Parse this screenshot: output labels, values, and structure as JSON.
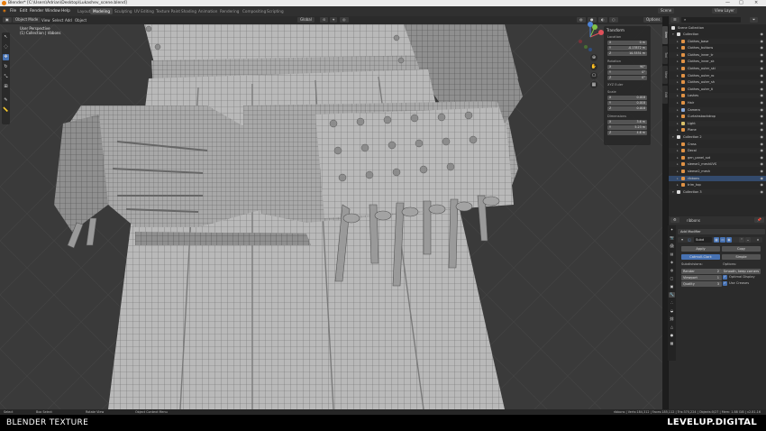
{
  "window": {
    "title": "Blender* [C:\\Users\\Adrian\\Desktop\\Lukashev_scene.blend]",
    "controls": [
      "—",
      "□",
      "×"
    ]
  },
  "menu": {
    "items": [
      "File",
      "Edit",
      "Render",
      "Window",
      "Help"
    ]
  },
  "workspaces": {
    "tabs": [
      "Layout",
      "Modeling",
      "Sculpting",
      "UV Editing",
      "Texture Paint",
      "Shading",
      "Animation",
      "Rendering",
      "Compositing",
      "Scripting"
    ],
    "active": "Modeling"
  },
  "topbar_right": {
    "scene": "Scene",
    "view_layer": "View Layer"
  },
  "header": {
    "mode": "Object Mode",
    "menus": [
      "View",
      "Select",
      "Add",
      "Object"
    ],
    "orientation": "Orientation",
    "transform_space": "Global",
    "pivot": "Global",
    "options": "Options"
  },
  "viewport": {
    "view_name": "User Perspective",
    "collection_info": "(1) Collection | ribbons"
  },
  "tools": [
    "cursor-arrow",
    "select-circle",
    "move",
    "rotate",
    "scale",
    "transform",
    "annotate",
    "measure"
  ],
  "gizmo": {
    "axes": [
      "X",
      "Y",
      "Z"
    ]
  },
  "sidebar_tabs": [
    "Item",
    "Tool",
    "View",
    "Edit"
  ],
  "transform_panel": {
    "title": "Transform",
    "location_label": "Location",
    "location": [
      {
        "axis": "X",
        "value": "0 m"
      },
      {
        "axis": "Y",
        "value": "-0.17872 m"
      },
      {
        "axis": "Z",
        "value": "10.3331 m"
      }
    ],
    "rotation_label": "Rotation",
    "rotation": [
      {
        "axis": "X",
        "value": "90°"
      },
      {
        "axis": "Y",
        "value": "0°"
      },
      {
        "axis": "Z",
        "value": "0°"
      }
    ],
    "mode_label": "XYZ Euler",
    "scale_label": "Scale",
    "scale": [
      {
        "axis": "X",
        "value": "0.018"
      },
      {
        "axis": "Y",
        "value": "0.018"
      },
      {
        "axis": "Z",
        "value": "0.018"
      }
    ],
    "dimensions_label": "Dimensions",
    "dimensions": [
      {
        "axis": "X",
        "value": "3.6 m"
      },
      {
        "axis": "Y",
        "value": "5.23 m"
      },
      {
        "axis": "Z",
        "value": "4.6 m"
      }
    ]
  },
  "outliner": {
    "title": "Scene Collection",
    "rows": [
      {
        "name": "Collection",
        "indent": 1,
        "color": "#ddd",
        "kind": "collection"
      },
      {
        "name": "Clothes_base",
        "indent": 2,
        "color": "#e09245",
        "kind": "mesh"
      },
      {
        "name": "Clothes_buttons",
        "indent": 2,
        "color": "#e09245",
        "kind": "mesh"
      },
      {
        "name": "Clothes_inner_tr",
        "indent": 2,
        "color": "#e09245",
        "kind": "mesh"
      },
      {
        "name": "Clothes_inner_sk",
        "indent": 2,
        "color": "#e09245",
        "kind": "mesh"
      },
      {
        "name": "Clothes_outer_ski",
        "indent": 2,
        "color": "#e09245",
        "kind": "mesh"
      },
      {
        "name": "Clothes_outer_ro",
        "indent": 2,
        "color": "#e09245",
        "kind": "mesh"
      },
      {
        "name": "Clothes_outer_sh",
        "indent": 2,
        "color": "#e09245",
        "kind": "mesh"
      },
      {
        "name": "Clothes_outer_ti",
        "indent": 2,
        "color": "#e09245",
        "kind": "mesh"
      },
      {
        "name": "Lashes",
        "indent": 2,
        "color": "#e09245",
        "kind": "mesh"
      },
      {
        "name": "Hair",
        "indent": 2,
        "color": "#e09245",
        "kind": "mesh"
      },
      {
        "name": "Camera",
        "indent": 2,
        "color": "#8aa8d8",
        "kind": "camera"
      },
      {
        "name": "Curtainsbackdrop",
        "indent": 2,
        "color": "#e09245",
        "kind": "mesh"
      },
      {
        "name": "Light",
        "indent": 2,
        "color": "#d8c06a",
        "kind": "light"
      },
      {
        "name": "Plane",
        "indent": 2,
        "color": "#e09245",
        "kind": "mesh"
      },
      {
        "name": "Collection 2",
        "indent": 1,
        "color": "#ddd",
        "kind": "collection"
      },
      {
        "name": "Cross",
        "indent": 2,
        "color": "#e09245",
        "kind": "mesh"
      },
      {
        "name": "Decal",
        "indent": 2,
        "color": "#e09245",
        "kind": "mesh"
      },
      {
        "name": "gen_panel_sot",
        "indent": 2,
        "color": "#e09245",
        "kind": "mesh"
      },
      {
        "name": "sleeve1_meshUVS",
        "indent": 2,
        "color": "#e09245",
        "kind": "mesh"
      },
      {
        "name": "sleeve2_mesh",
        "indent": 2,
        "color": "#e09245",
        "kind": "mesh"
      },
      {
        "name": "ribbons",
        "indent": 2,
        "color": "#e09245",
        "kind": "mesh",
        "selected": true
      },
      {
        "name": "trim_top",
        "indent": 2,
        "color": "#e09245",
        "kind": "mesh"
      },
      {
        "name": "Collection 3",
        "indent": 1,
        "color": "#ddd",
        "kind": "collection"
      }
    ]
  },
  "properties": {
    "object_label": "ribbons",
    "add_modifier": "Add Modifier",
    "modifier_name": "Subd",
    "apply": "Apply",
    "copy": "Copy",
    "catmull_clark": "Catmull-Clark",
    "simple": "Simple",
    "subdivisions_label": "Subdivisions:",
    "render_label": "Render",
    "render_value": "2",
    "viewport_label": "Viewport",
    "viewport_value": "1",
    "quality_label": "Quality",
    "quality_value": "3",
    "options_label": "Options:",
    "uv_smooth": "Smooth, keep corners",
    "optimal_display": "Optimal Display",
    "use_creases": "Use Creases"
  },
  "statusbar": {
    "left": "Select",
    "middle_left": "Box Select",
    "middle": "Rotate View",
    "middle_right": "Object Context Menu",
    "right": "ribbons | Verts:184,312 | Faces:185,112 | Tris:370,224 | Objects:0/27 | Mem: 1.88 GiB | v2.81.16"
  },
  "footer": {
    "left": "BLENDER TEXTURE",
    "right": "LEVELUP.DIGITAL"
  }
}
